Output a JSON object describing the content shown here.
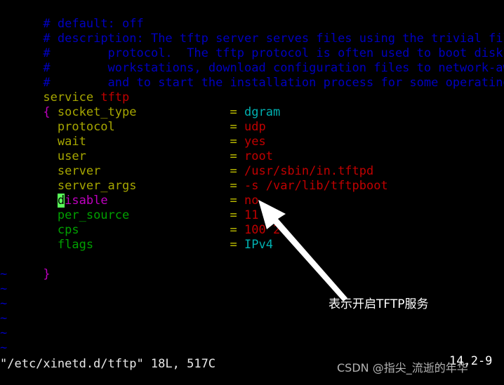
{
  "editor": {
    "name": "vim",
    "filename": "/etc/xinetd.d/tftp",
    "statusline": "\"/etc/xinetd.d/tftp\" 18L, 517C",
    "ruler": "14,2-9",
    "cursor_char": "d",
    "tilde_char": "~",
    "tilde_count": 6
  },
  "comments": [
    {
      "hash": "# ",
      "text": "default: off"
    },
    {
      "hash": "# ",
      "text": "description: The tftp server serves files using the trivial file trans"
    },
    {
      "hash": "#",
      "text": "        protocol.  The tftp protocol is often used to boot diskless \\"
    },
    {
      "hash": "#",
      "text": "        workstations, download configuration files to network-aware prin"
    },
    {
      "hash": "#",
      "text": "        and to start the installation process for some operating systems"
    }
  ],
  "service": {
    "keyword": "service",
    "name": "tftp",
    "open_brace": "{",
    "close_brace": "}"
  },
  "attributes": [
    {
      "name": "socket_type",
      "eq": "=",
      "value": "dgram",
      "name_color": "olive",
      "value_color": "cyan"
    },
    {
      "name": "protocol",
      "eq": "=",
      "value": "udp",
      "name_color": "olive",
      "value_color": "red"
    },
    {
      "name": "wait",
      "eq": "=",
      "value": "yes",
      "name_color": "olive",
      "value_color": "red"
    },
    {
      "name": "user",
      "eq": "=",
      "value": "root",
      "name_color": "olive",
      "value_color": "red"
    },
    {
      "name": "server",
      "eq": "=",
      "value": "/usr/sbin/in.tftpd",
      "name_color": "olive",
      "value_color": "red"
    },
    {
      "name": "server_args",
      "eq": "=",
      "value": "-s /var/lib/tftpboot",
      "name_color": "olive2",
      "value_color": "red"
    },
    {
      "name": "disable",
      "eq": "=",
      "value": "no",
      "name_color": "magenta",
      "value_color": "red",
      "cursor": true
    },
    {
      "name": "per_source",
      "eq": "=",
      "value": "11",
      "name_color": "green",
      "value_color": "red"
    },
    {
      "name": "cps",
      "eq": "=",
      "value": "100 2",
      "name_color": "green",
      "value_color": "red"
    },
    {
      "name": "flags",
      "eq": "=",
      "value": "IPv4",
      "name_color": "green",
      "value_color": "cyan"
    }
  ],
  "annotation": {
    "text": "表示开启TFTP服务",
    "arrow_name": "pointer-arrow",
    "color": "#ffffff"
  },
  "watermark": {
    "text": "CSDN @指尖_流逝的年华",
    "color": "#c2c2c2"
  }
}
